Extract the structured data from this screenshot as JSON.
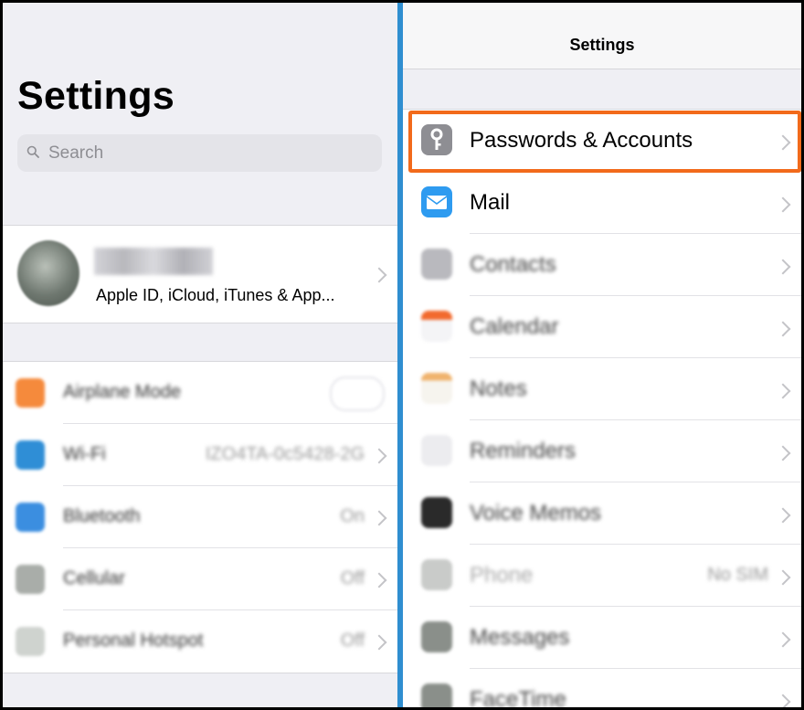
{
  "left": {
    "title": "Settings",
    "search": {
      "placeholder": "Search"
    },
    "profile": {
      "name": "",
      "subtitle": "Apple ID, iCloud, iTunes & App..."
    },
    "rows": [
      {
        "label": "Airplane Mode",
        "value": "",
        "icon": "airplane-icon",
        "color": "#f58a3c",
        "control": "toggle"
      },
      {
        "label": "Wi-Fi",
        "value": "IZO4TA-0c5428-2G",
        "icon": "wifi-icon",
        "color": "#2f8ed6"
      },
      {
        "label": "Bluetooth",
        "value": "On",
        "icon": "bluetooth-icon",
        "color": "#3b8ee0"
      },
      {
        "label": "Cellular",
        "value": "Off",
        "icon": "cellular-icon",
        "color": "#a9ada9"
      },
      {
        "label": "Personal Hotspot",
        "value": "Off",
        "icon": "hotspot-icon",
        "color": "#cfd3cf"
      }
    ]
  },
  "right": {
    "nav_title": "Settings",
    "rows": [
      {
        "label": "Passwords & Accounts",
        "value": "",
        "icon": "key-icon",
        "color": "#8e8e93",
        "highlighted": true,
        "blurred": false
      },
      {
        "label": "Mail",
        "value": "",
        "icon": "mail-icon",
        "color": "#2e9bf0",
        "blurred": false
      },
      {
        "label": "Contacts",
        "value": "",
        "icon": "contacts-icon",
        "color": "#b9b9be",
        "blurred": true
      },
      {
        "label": "Calendar",
        "value": "",
        "icon": "calendar-icon",
        "color": "#f26a2e",
        "blurred": true
      },
      {
        "label": "Notes",
        "value": "",
        "icon": "notes-icon",
        "color": "#f0b36e",
        "blurred": true
      },
      {
        "label": "Reminders",
        "value": "",
        "icon": "reminders-icon",
        "color": "#d8d8dc",
        "blurred": true
      },
      {
        "label": "Voice Memos",
        "value": "",
        "icon": "voice-memos-icon",
        "color": "#2a2a2a",
        "blurred": true
      },
      {
        "label": "Phone",
        "value": "No SIM",
        "icon": "phone-icon",
        "color": "#c9cbc9",
        "blurred": true
      },
      {
        "label": "Messages",
        "value": "",
        "icon": "messages-icon",
        "color": "#8a8f8a",
        "blurred": true
      },
      {
        "label": "FaceTime",
        "value": "",
        "icon": "facetime-icon",
        "color": "#8a8f8a",
        "blurred": true
      }
    ]
  },
  "colors": {
    "divider": "#2f8ed0",
    "highlight": "#f26a1b"
  }
}
